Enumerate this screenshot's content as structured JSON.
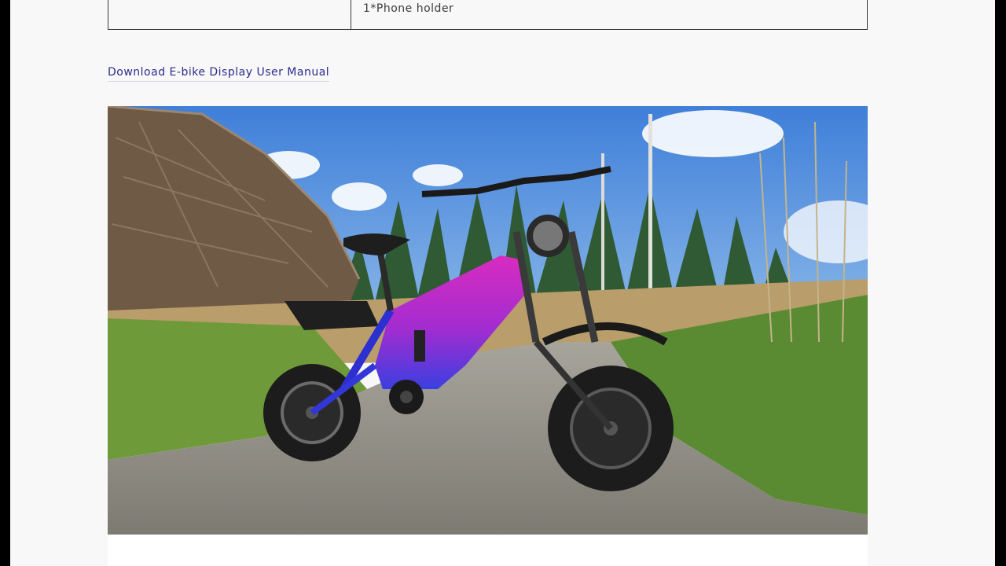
{
  "spec_table": {
    "row": {
      "label": "",
      "value": "1*Phone holder"
    }
  },
  "manual_link": {
    "label": "Download E-bike Display User Manual"
  },
  "photo": {
    "subject": "ebike-product-photo"
  },
  "colors": {
    "link": "#2b2b8e",
    "page_bg": "#f8f8f8",
    "border": "#3a3a3a"
  }
}
